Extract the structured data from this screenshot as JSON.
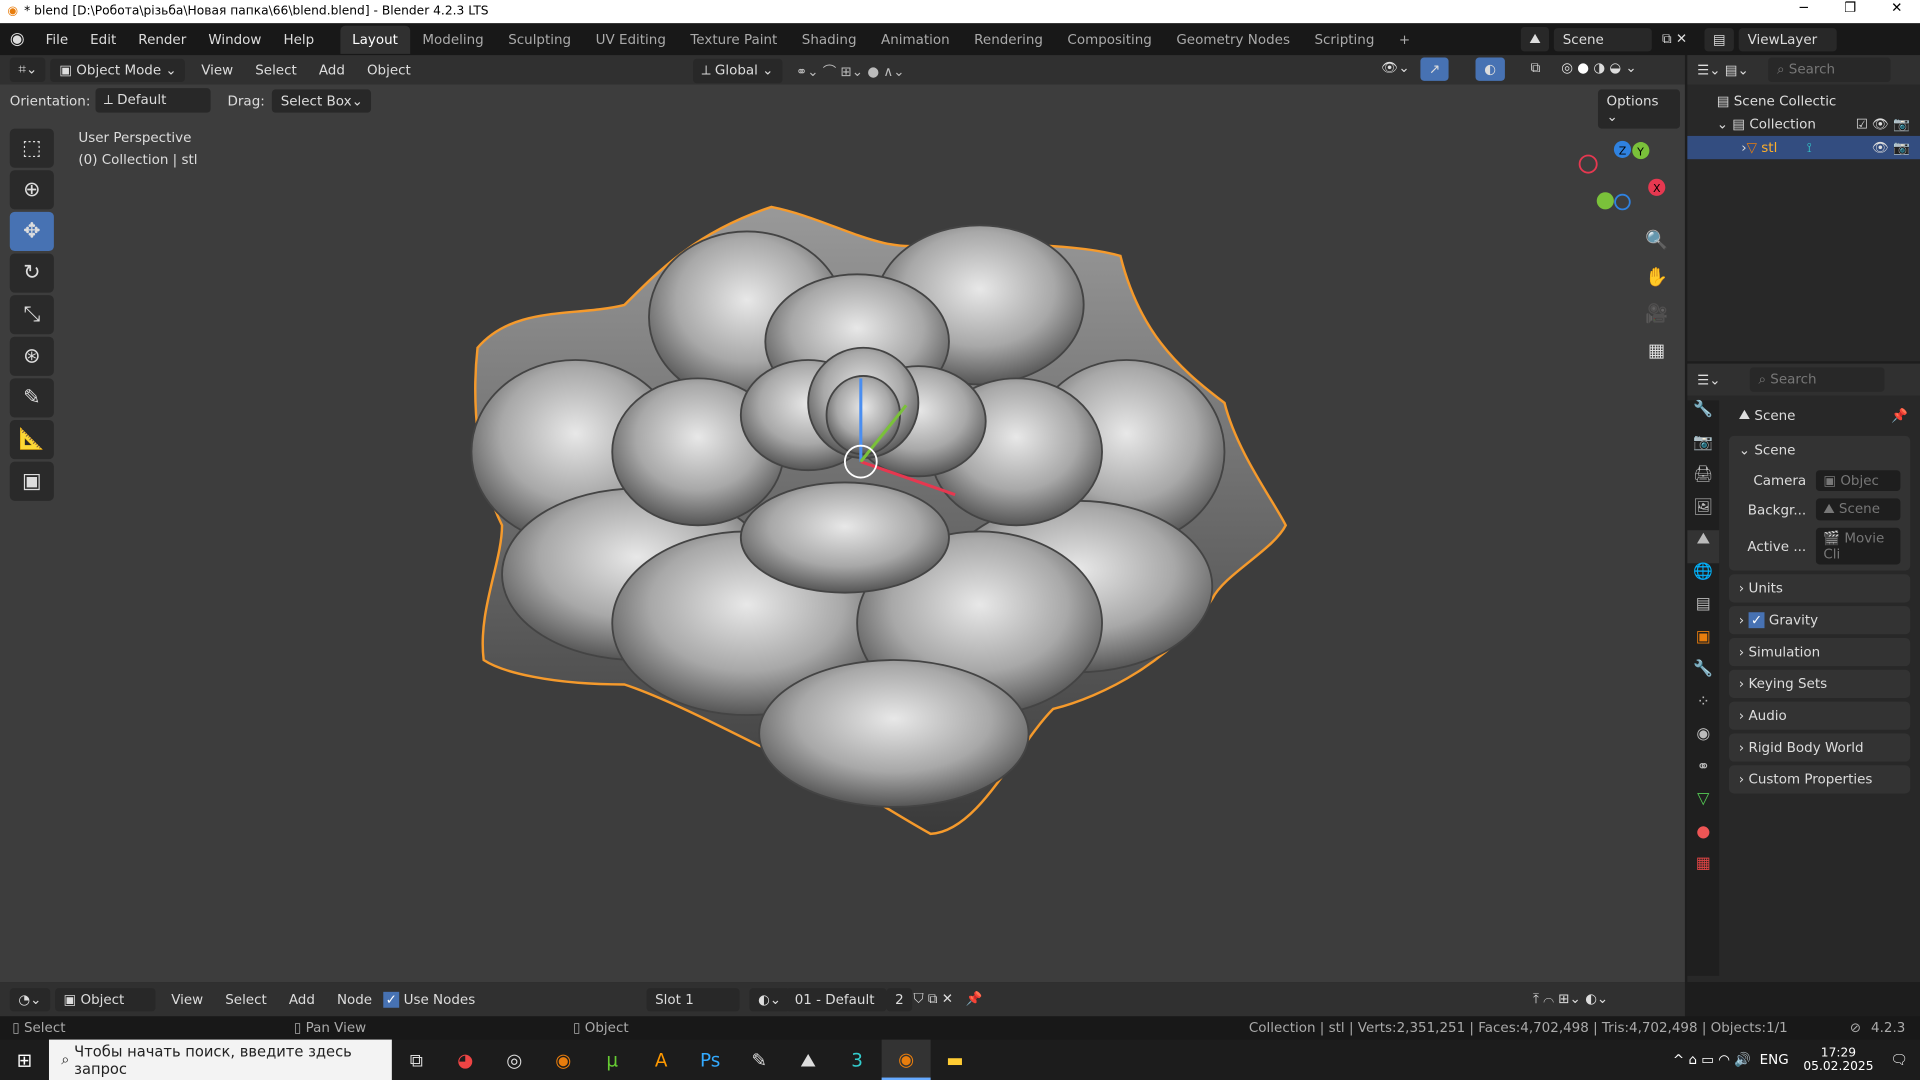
{
  "title": "* blend [D:\\Робота\\різьба\\Новая папка\\66\\blend.blend] - Blender 4.2.3 LTS",
  "menu": [
    "File",
    "Edit",
    "Render",
    "Window",
    "Help"
  ],
  "workspaces": [
    "Layout",
    "Modeling",
    "Sculpting",
    "UV Editing",
    "Texture Paint",
    "Shading",
    "Animation",
    "Rendering",
    "Compositing",
    "Geometry Nodes",
    "Scripting"
  ],
  "scene": "Scene",
  "view_layer": "ViewLayer",
  "header": {
    "mode": "Object Mode",
    "view": "View",
    "select": "Select",
    "add": "Add",
    "object": "Object",
    "transform": "Global"
  },
  "toolhead": {
    "orientation_label": "Orientation:",
    "orientation": "Default",
    "drag_label": "Drag:",
    "drag": "Select Box",
    "options": "Options"
  },
  "viewport": {
    "perspective": "User Perspective",
    "collection": "(0) Collection | stl"
  },
  "outliner": {
    "search": "Search",
    "items": [
      "Scene Collectic",
      "Collection",
      "stl"
    ]
  },
  "props": {
    "search": "Search",
    "context": "Scene",
    "panel": "Scene",
    "camera_label": "Camera",
    "camera": "Objec",
    "bg_label": "Backgr...",
    "bg": "Scene",
    "clip_label": "Active ...",
    "clip": "Movie Cli",
    "sections": [
      "Units",
      "Gravity",
      "Simulation",
      "Keying Sets",
      "Audio",
      "Rigid Body World",
      "Custom Properties"
    ]
  },
  "bottom": {
    "type": "Object",
    "view": "View",
    "select": "Select",
    "add": "Add",
    "node": "Node",
    "use_nodes": "Use Nodes",
    "slot": "Slot 1",
    "material": "01 - Default",
    "users": "2"
  },
  "status": {
    "select": "Select",
    "pan": "Pan View",
    "object": "Object",
    "stats": "Collection | stl | Verts:2,351,251 | Faces:4,702,498 | Tris:4,702,498 | Objects:1/1",
    "version": "4.2.3"
  },
  "taskbar": {
    "search": "Чтобы начать поиск, введите здесь запрос",
    "lang": "ENG",
    "time": "17:29",
    "date": "05.02.2025"
  }
}
